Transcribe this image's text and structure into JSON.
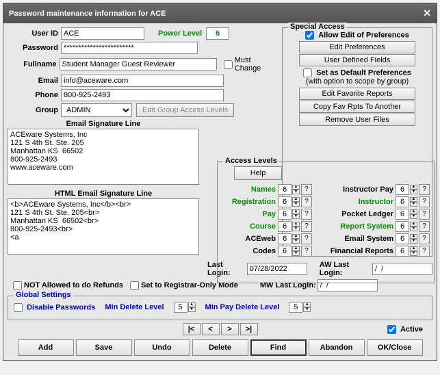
{
  "title": "Password maintenance information for ACE",
  "fields": {
    "userId": {
      "label": "User ID",
      "value": "ACE"
    },
    "powerLevel": {
      "label": "Power Level",
      "value": "6"
    },
    "password": {
      "label": "Password",
      "value": "************************"
    },
    "mustChange": {
      "label": "Must Change"
    },
    "fullname": {
      "label": "Fullname",
      "value": "Student Manager Guest Reviewer"
    },
    "email": {
      "label": "Email",
      "value": "info@aceware.com"
    },
    "phone": {
      "label": "Phone",
      "value": "800-925-2493"
    },
    "group": {
      "label": "Group",
      "value": "ADMIN"
    },
    "editGroup": "Edit Group Access Levels"
  },
  "specialAccess": {
    "legend": "Special Access",
    "allowEdit": "Allow Edit of Preferences",
    "editPrefs": "Edit Preferences",
    "userDef": "User Defined Fields",
    "setDefault": "Set as Default Preferences",
    "scopeNote": "(with option to scope by group)",
    "editFav": "Edit Favorite Reports",
    "copyFav": "Copy Fav Rpts To Another",
    "removeUser": "Remove User Files"
  },
  "sig": {
    "title": "Email Signature Line",
    "text": "ACEware Systems, Inc\n121 S 4th St. Ste. 205\nManhattan KS  66502\n800-925-2493\nwww.aceware.com",
    "htmlTitle": "HTML Email Signature Line",
    "htmlText": "<b>ACEware Systems, Inc</b><br>\n121 S 4th St. Ste. 205<br>\nManhattan KS  66502<br>\n800-925-2493<br>\n<a"
  },
  "accessLevels": {
    "legend": "Access Levels",
    "help": "Help",
    "left": [
      {
        "label": "Names",
        "g": true,
        "val": "6"
      },
      {
        "label": "Registration",
        "g": true,
        "val": "6"
      },
      {
        "label": "Pay",
        "g": true,
        "val": "6"
      },
      {
        "label": "Course",
        "g": true,
        "val": "6"
      },
      {
        "label": "ACEweb",
        "g": false,
        "val": "6"
      },
      {
        "label": "Codes",
        "g": false,
        "val": "6"
      }
    ],
    "right": [
      {
        "label": "Instructor Pay",
        "g": false,
        "val": "6"
      },
      {
        "label": "Instructor",
        "g": true,
        "val": "6"
      },
      {
        "label": "Pocket Ledger",
        "g": false,
        "val": "6"
      },
      {
        "label": "Report System",
        "g": true,
        "val": "6"
      },
      {
        "label": "Email System",
        "g": false,
        "val": "6"
      },
      {
        "label": "Financial Reports",
        "g": false,
        "val": "6"
      }
    ]
  },
  "logins": {
    "last": {
      "label": "Last Login:",
      "value": "07/28/2022"
    },
    "aw": {
      "label": "AW Last Login:",
      "value": "/  /"
    },
    "mw": {
      "label": "MW Last Login:",
      "value": "/  /"
    }
  },
  "opts": {
    "noRefunds": "NOT Allowed to do Refunds",
    "regOnly": "Set to Registrar-Only Mode"
  },
  "global": {
    "legend": "Global Settings",
    "disable": "Disable Passwords",
    "minDel": "Min Delete Level",
    "minDelVal": "5",
    "minPay": "Min Pay Delete Level",
    "minPayVal": "5"
  },
  "nav": {
    "first": "|<",
    "prev": "<",
    "next": ">",
    "last": ">|"
  },
  "active": "Active",
  "buttons": {
    "add": "Add",
    "save": "Save",
    "undo": "Undo",
    "delete": "Delete",
    "find": "Find",
    "abandon": "Abandon",
    "ok": "OK/Close"
  }
}
